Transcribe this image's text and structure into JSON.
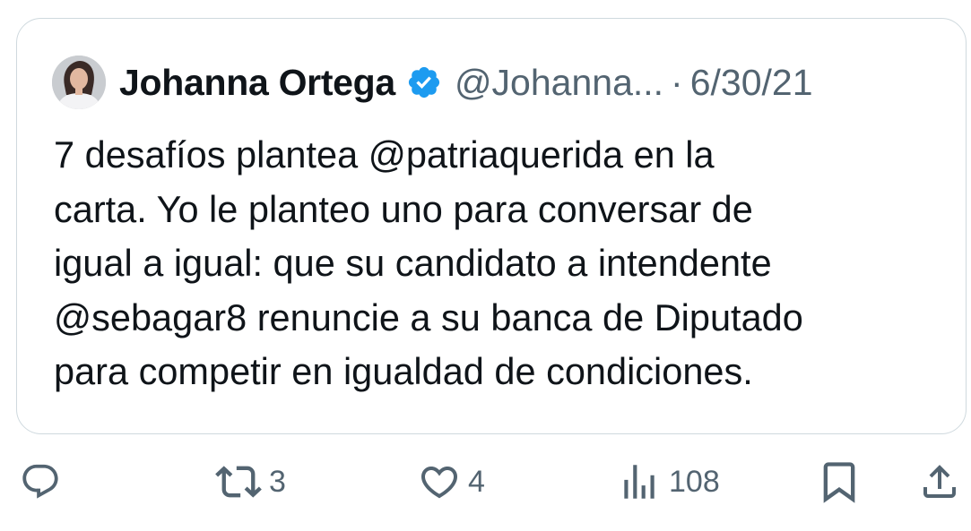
{
  "quoted_tweet": {
    "display_name": "Johanna Ortega",
    "handle": "@Johanna...",
    "separator": "·",
    "date": "6/30/21",
    "verified": true,
    "text_lines": [
      "7 desafíos plantea @patriaquerida  en la",
      "carta. Yo le planteo uno para conversar de",
      "igual a igual: que su candidato a intendente",
      "@sebagar8 renuncie a su banca de Diputado",
      "para competir en igualdad de condiciones."
    ]
  },
  "actions": {
    "reply": {
      "icon": "reply-icon"
    },
    "retweet": {
      "icon": "retweet-icon",
      "count": "3"
    },
    "like": {
      "icon": "heart-icon",
      "count": "4"
    },
    "views": {
      "icon": "views-icon",
      "count": "108"
    },
    "bookmark": {
      "icon": "bookmark-icon"
    },
    "share": {
      "icon": "share-icon"
    }
  },
  "colors": {
    "text": "#0f1419",
    "secondary": "#536471",
    "border": "#cfd9de",
    "verified": "#1d9bf0"
  }
}
